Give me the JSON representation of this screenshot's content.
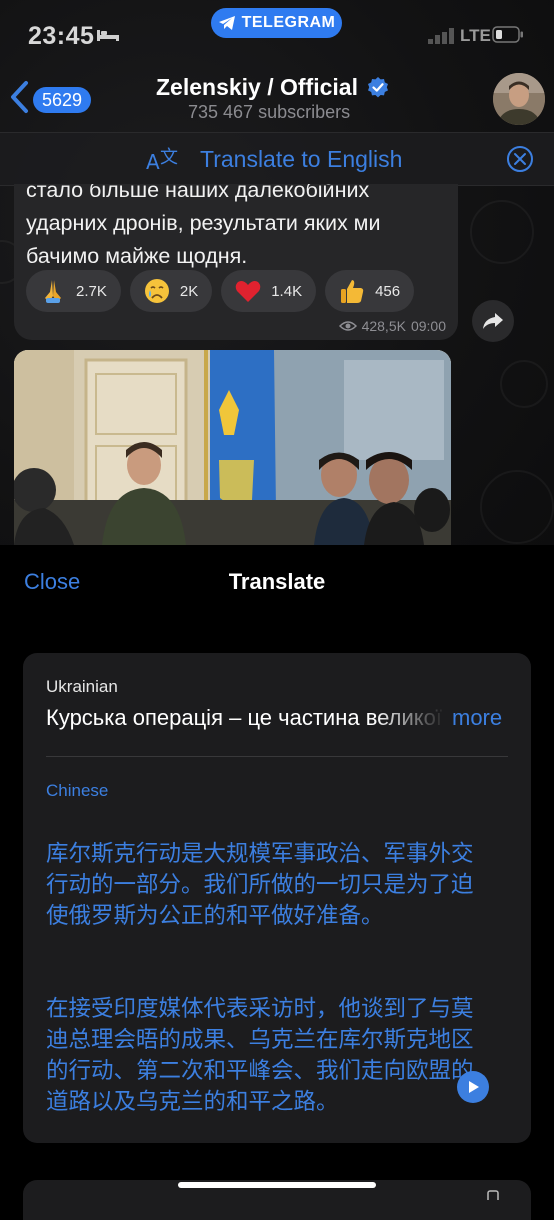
{
  "status_bar": {
    "time": "23:45",
    "app_pill": "TELEGRAM",
    "network": "LTE"
  },
  "header": {
    "back_count": "5629",
    "title": "Zelenskiy / Official",
    "subscribers": "735 467 subscribers"
  },
  "translate_bar": {
    "label": "Translate to English"
  },
  "message": {
    "text": "стало більше наших далекобійних\nударних дронів, результати яких ми\nбачимо майже щодня.",
    "reactions": [
      {
        "icon": "pray-icon",
        "count": "2.7K"
      },
      {
        "icon": "crying-face-icon",
        "count": "2K"
      },
      {
        "icon": "red-heart-icon",
        "count": "1.4K"
      },
      {
        "icon": "thumbs-up-icon",
        "count": "456"
      }
    ],
    "views": "428,5K",
    "time": "09:00"
  },
  "sheet": {
    "close_label": "Close",
    "title": "Translate",
    "source_language": "Ukrainian",
    "source_text": "Курська операція – це частина великої",
    "more_label": "more",
    "target_language": "Chinese",
    "target_paragraphs": [
      "库尔斯克行动是大规模军事政治、军事外交行动的一部分。我们所做的一切只是为了迫使俄罗斯为公正的和平做好准备。",
      "在接受印度媒体代表采访时，他谈到了与莫迪总理会晤的成果、乌克兰在库尔斯克地区的行动、第二次和平峰会、我们走向欧盟的道路以及乌克兰的和平之路。"
    ]
  },
  "colors": {
    "accent": "#3c7fe0",
    "telegram_pill": "#2f7bf0",
    "bubble": "#262628",
    "card": "#1c1c1e"
  }
}
